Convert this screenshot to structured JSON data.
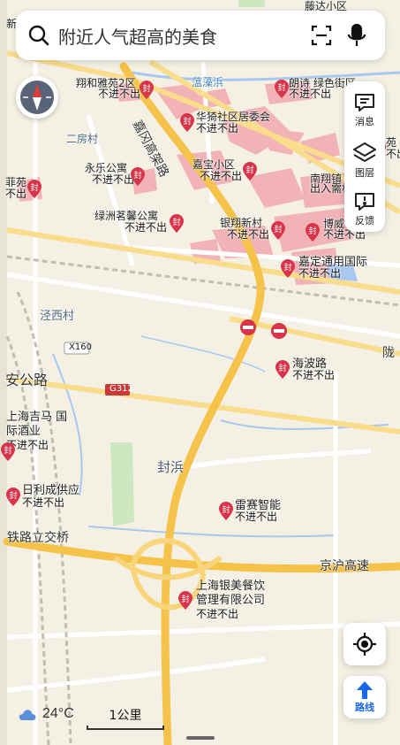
{
  "search": {
    "placeholder": "附近人气超高的美食"
  },
  "side_panel": {
    "messages": "消息",
    "layers": "图层",
    "feedback": "反馈"
  },
  "buttons": {
    "route": "路线"
  },
  "weather": {
    "temperature": "24°C"
  },
  "scale": {
    "label": "1公里"
  },
  "roads": {
    "jiagang": "嘉冈高架路",
    "x160": "X160",
    "g312": "G312",
    "jinghu": "京沪高速",
    "an_road": "安公路",
    "tielu": "铁路立交桥",
    "long": "陇"
  },
  "places": {
    "erfang": "二房村",
    "jingxi": "泾西村",
    "fengbang": "封浜",
    "yuanzaobang": "蕰藻浜",
    "nanxiang": "南翔镇",
    "nanxiang_sub": "出入需机",
    "xin": "新",
    "shuzi": "藤达小区"
  },
  "pois": [
    {
      "name": "翔和雅苑2区",
      "status": "不进不出"
    },
    {
      "name": "朗诗 绿色街区",
      "status": "不进不出"
    },
    {
      "name": "华猗社区居委会",
      "status": "不进不出"
    },
    {
      "name": "嘉宝小区",
      "status": "不进不出"
    },
    {
      "name": "永乐公寓",
      "status": "不进不出"
    },
    {
      "name": "菲苑",
      "status": "不出"
    },
    {
      "name": "绿洲茗馨公寓",
      "status": "不进不出"
    },
    {
      "name": "银翔新村",
      "status": "不进不出"
    },
    {
      "name": "博威",
      "status": "不进不出"
    },
    {
      "name": "嘉定通用国际",
      "status": "不进不出"
    },
    {
      "name": "海波路",
      "status": "不进不出"
    },
    {
      "name": "上海吉马 国际酒业",
      "status": "不进不出"
    },
    {
      "name": "日利成供应",
      "status": "不进不出"
    },
    {
      "name": "雷赛智能",
      "status": "不进不出"
    },
    {
      "name": "上海银美餐饮 管理有限公司",
      "status": "不进不出"
    },
    {
      "name": "苑",
      "status": "不出"
    }
  ],
  "pin_glyph": "封",
  "colors": {
    "map_bg": "#f4f1e4",
    "highway": "#f5c24a",
    "pin": "#d8344a",
    "zone": "#f2a9b0",
    "water": "#a8c8f0",
    "green": "#cde8c0",
    "accent": "#1a66e8"
  },
  "icons": [
    "search-icon",
    "scan-icon",
    "microphone-icon",
    "compass-icon",
    "message-icon",
    "layers-icon",
    "feedback-icon",
    "locate-icon",
    "route-arrow-icon",
    "cloud-icon",
    "no-entry-icon"
  ]
}
